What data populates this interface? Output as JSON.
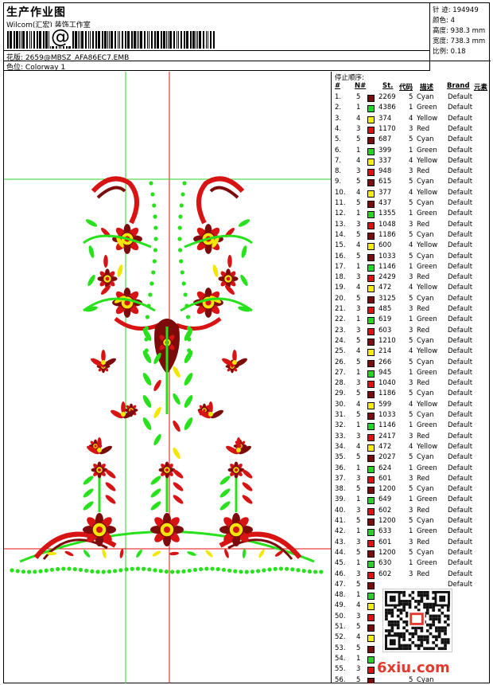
{
  "header": {
    "title": "生产作业图",
    "company": "Wilcom(汇宏) 装饰工作室",
    "barcode_char": "@",
    "file_label": "花版:",
    "file_name": "2659@MBSZ_AFA86EC7.EMB",
    "colorway_label": "色位:",
    "colorway_name": "Colorway 1"
  },
  "stats": [
    {
      "label": "针 迹:",
      "value": "194949"
    },
    {
      "label": "颜色:",
      "value": "4"
    },
    {
      "label": "高度:",
      "value": "938.3 mm"
    },
    {
      "label": "宽度:",
      "value": "738.3 mm"
    },
    {
      "label": "比例:",
      "value": "0.18"
    }
  ],
  "stop_list": {
    "title": "停止顺序:",
    "headers": {
      "num": "#",
      "needle": "N#",
      "st": "St.",
      "code": "代码",
      "desc": "描述",
      "brand": "Brand",
      "element": "元素"
    },
    "colors": {
      "1": "#1fd81f",
      "3": "#e01010",
      "4": "#f6f000",
      "5": "#7a0d0d"
    },
    "rows": [
      {
        "n": "1.",
        "nd": "5",
        "st": "2269",
        "code": "5",
        "desc": "Cyan",
        "brand": "Default"
      },
      {
        "n": "2.",
        "nd": "1",
        "st": "4386",
        "code": "1",
        "desc": "Green",
        "brand": "Default"
      },
      {
        "n": "3.",
        "nd": "4",
        "st": "374",
        "code": "4",
        "desc": "Yellow",
        "brand": "Default"
      },
      {
        "n": "4.",
        "nd": "3",
        "st": "1170",
        "code": "3",
        "desc": "Red",
        "brand": "Default"
      },
      {
        "n": "5.",
        "nd": "5",
        "st": "687",
        "code": "5",
        "desc": "Cyan",
        "brand": "Default"
      },
      {
        "n": "6.",
        "nd": "1",
        "st": "399",
        "code": "1",
        "desc": "Green",
        "brand": "Default"
      },
      {
        "n": "7.",
        "nd": "4",
        "st": "337",
        "code": "4",
        "desc": "Yellow",
        "brand": "Default"
      },
      {
        "n": "8.",
        "nd": "3",
        "st": "948",
        "code": "3",
        "desc": "Red",
        "brand": "Default"
      },
      {
        "n": "9.",
        "nd": "5",
        "st": "615",
        "code": "5",
        "desc": "Cyan",
        "brand": "Default"
      },
      {
        "n": "10.",
        "nd": "4",
        "st": "377",
        "code": "4",
        "desc": "Yellow",
        "brand": "Default"
      },
      {
        "n": "11.",
        "nd": "5",
        "st": "437",
        "code": "5",
        "desc": "Cyan",
        "brand": "Default"
      },
      {
        "n": "12.",
        "nd": "1",
        "st": "1355",
        "code": "1",
        "desc": "Green",
        "brand": "Default"
      },
      {
        "n": "13.",
        "nd": "3",
        "st": "1048",
        "code": "3",
        "desc": "Red",
        "brand": "Default"
      },
      {
        "n": "14.",
        "nd": "5",
        "st": "1186",
        "code": "5",
        "desc": "Cyan",
        "brand": "Default"
      },
      {
        "n": "15.",
        "nd": "4",
        "st": "600",
        "code": "4",
        "desc": "Yellow",
        "brand": "Default"
      },
      {
        "n": "16.",
        "nd": "5",
        "st": "1033",
        "code": "5",
        "desc": "Cyan",
        "brand": "Default"
      },
      {
        "n": "17.",
        "nd": "1",
        "st": "1146",
        "code": "1",
        "desc": "Green",
        "brand": "Default"
      },
      {
        "n": "18.",
        "nd": "3",
        "st": "2429",
        "code": "3",
        "desc": "Red",
        "brand": "Default"
      },
      {
        "n": "19.",
        "nd": "4",
        "st": "472",
        "code": "4",
        "desc": "Yellow",
        "brand": "Default"
      },
      {
        "n": "20.",
        "nd": "5",
        "st": "3125",
        "code": "5",
        "desc": "Cyan",
        "brand": "Default"
      },
      {
        "n": "21.",
        "nd": "3",
        "st": "485",
        "code": "3",
        "desc": "Red",
        "brand": "Default"
      },
      {
        "n": "22.",
        "nd": "1",
        "st": "619",
        "code": "1",
        "desc": "Green",
        "brand": "Default"
      },
      {
        "n": "23.",
        "nd": "3",
        "st": "603",
        "code": "3",
        "desc": "Red",
        "brand": "Default"
      },
      {
        "n": "24.",
        "nd": "5",
        "st": "1210",
        "code": "5",
        "desc": "Cyan",
        "brand": "Default"
      },
      {
        "n": "25.",
        "nd": "4",
        "st": "214",
        "code": "4",
        "desc": "Yellow",
        "brand": "Default"
      },
      {
        "n": "26.",
        "nd": "5",
        "st": "266",
        "code": "5",
        "desc": "Cyan",
        "brand": "Default"
      },
      {
        "n": "27.",
        "nd": "1",
        "st": "945",
        "code": "1",
        "desc": "Green",
        "brand": "Default"
      },
      {
        "n": "28.",
        "nd": "3",
        "st": "1040",
        "code": "3",
        "desc": "Red",
        "brand": "Default"
      },
      {
        "n": "29.",
        "nd": "5",
        "st": "1186",
        "code": "5",
        "desc": "Cyan",
        "brand": "Default"
      },
      {
        "n": "30.",
        "nd": "4",
        "st": "599",
        "code": "4",
        "desc": "Yellow",
        "brand": "Default"
      },
      {
        "n": "31.",
        "nd": "5",
        "st": "1033",
        "code": "5",
        "desc": "Cyan",
        "brand": "Default"
      },
      {
        "n": "32.",
        "nd": "1",
        "st": "1146",
        "code": "1",
        "desc": "Green",
        "brand": "Default"
      },
      {
        "n": "33.",
        "nd": "3",
        "st": "2417",
        "code": "3",
        "desc": "Red",
        "brand": "Default"
      },
      {
        "n": "34.",
        "nd": "4",
        "st": "472",
        "code": "4",
        "desc": "Yellow",
        "brand": "Default"
      },
      {
        "n": "35.",
        "nd": "5",
        "st": "2027",
        "code": "5",
        "desc": "Cyan",
        "brand": "Default"
      },
      {
        "n": "36.",
        "nd": "1",
        "st": "624",
        "code": "1",
        "desc": "Green",
        "brand": "Default"
      },
      {
        "n": "37.",
        "nd": "3",
        "st": "601",
        "code": "3",
        "desc": "Red",
        "brand": "Default"
      },
      {
        "n": "38.",
        "nd": "5",
        "st": "1200",
        "code": "5",
        "desc": "Cyan",
        "brand": "Default"
      },
      {
        "n": "39.",
        "nd": "1",
        "st": "649",
        "code": "1",
        "desc": "Green",
        "brand": "Default"
      },
      {
        "n": "40.",
        "nd": "3",
        "st": "602",
        "code": "3",
        "desc": "Red",
        "brand": "Default"
      },
      {
        "n": "41.",
        "nd": "5",
        "st": "1200",
        "code": "5",
        "desc": "Cyan",
        "brand": "Default"
      },
      {
        "n": "42.",
        "nd": "1",
        "st": "633",
        "code": "1",
        "desc": "Green",
        "brand": "Default"
      },
      {
        "n": "43.",
        "nd": "3",
        "st": "601",
        "code": "3",
        "desc": "Red",
        "brand": "Default"
      },
      {
        "n": "44.",
        "nd": "5",
        "st": "1200",
        "code": "5",
        "desc": "Cyan",
        "brand": "Default"
      },
      {
        "n": "45.",
        "nd": "1",
        "st": "630",
        "code": "1",
        "desc": "Green",
        "brand": "Default"
      },
      {
        "n": "46.",
        "nd": "3",
        "st": "602",
        "code": "3",
        "desc": "Red",
        "brand": "Default"
      },
      {
        "n": "47.",
        "nd": "5",
        "st": "",
        "code": "",
        "desc": "",
        "brand": "Default"
      },
      {
        "n": "48.",
        "nd": "1",
        "st": "",
        "code": "",
        "desc": "",
        "brand": ""
      },
      {
        "n": "49.",
        "nd": "4",
        "st": "",
        "code": "",
        "desc": "",
        "brand": ""
      },
      {
        "n": "50.",
        "nd": "3",
        "st": "",
        "code": "",
        "desc": "",
        "brand": ""
      },
      {
        "n": "51.",
        "nd": "5",
        "st": "",
        "code": "",
        "desc": "",
        "brand": ""
      },
      {
        "n": "52.",
        "nd": "4",
        "st": "",
        "code": "",
        "desc": "",
        "brand": ""
      },
      {
        "n": "53.",
        "nd": "5",
        "st": "",
        "code": "",
        "desc": "",
        "brand": ""
      },
      {
        "n": "54.",
        "nd": "1",
        "st": "",
        "code": "",
        "desc": "",
        "brand": ""
      },
      {
        "n": "55.",
        "nd": "3",
        "st": "",
        "code": "",
        "desc": "",
        "brand": ""
      },
      {
        "n": "56.",
        "nd": "5",
        "st": "",
        "code": "5",
        "desc": "Cyan",
        "brand": ""
      }
    ]
  },
  "watermark": {
    "site": "6xiu.com"
  }
}
